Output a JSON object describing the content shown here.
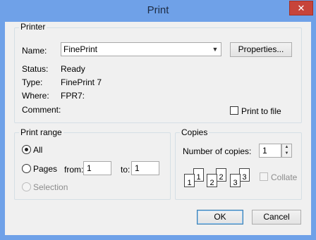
{
  "window": {
    "title": "Print",
    "close_glyph": "✕"
  },
  "printer": {
    "group_label": "Printer",
    "name_label": "Name:",
    "name_value": "FinePrint",
    "properties_label": "Properties...",
    "status_label": "Status:",
    "status_value": "Ready",
    "type_label": "Type:",
    "type_value": "FinePrint 7",
    "where_label": "Where:",
    "where_value": "FPR7:",
    "comment_label": "Comment:",
    "print_to_file_label": "Print to file",
    "print_to_file_checked": false
  },
  "print_range": {
    "group_label": "Print range",
    "all_label": "All",
    "pages_label": "Pages",
    "from_label": "from:",
    "from_value": "1",
    "to_label": "to:",
    "to_value": "1",
    "selection_label": "Selection",
    "selected": "All"
  },
  "copies": {
    "group_label": "Copies",
    "number_label": "Number of copies:",
    "number_value": "1",
    "collate_label": "Collate",
    "collate_checked": false,
    "page_numbers": [
      "1",
      "1",
      "2",
      "2",
      "3",
      "3"
    ]
  },
  "buttons": {
    "ok_label": "OK",
    "cancel_label": "Cancel"
  }
}
